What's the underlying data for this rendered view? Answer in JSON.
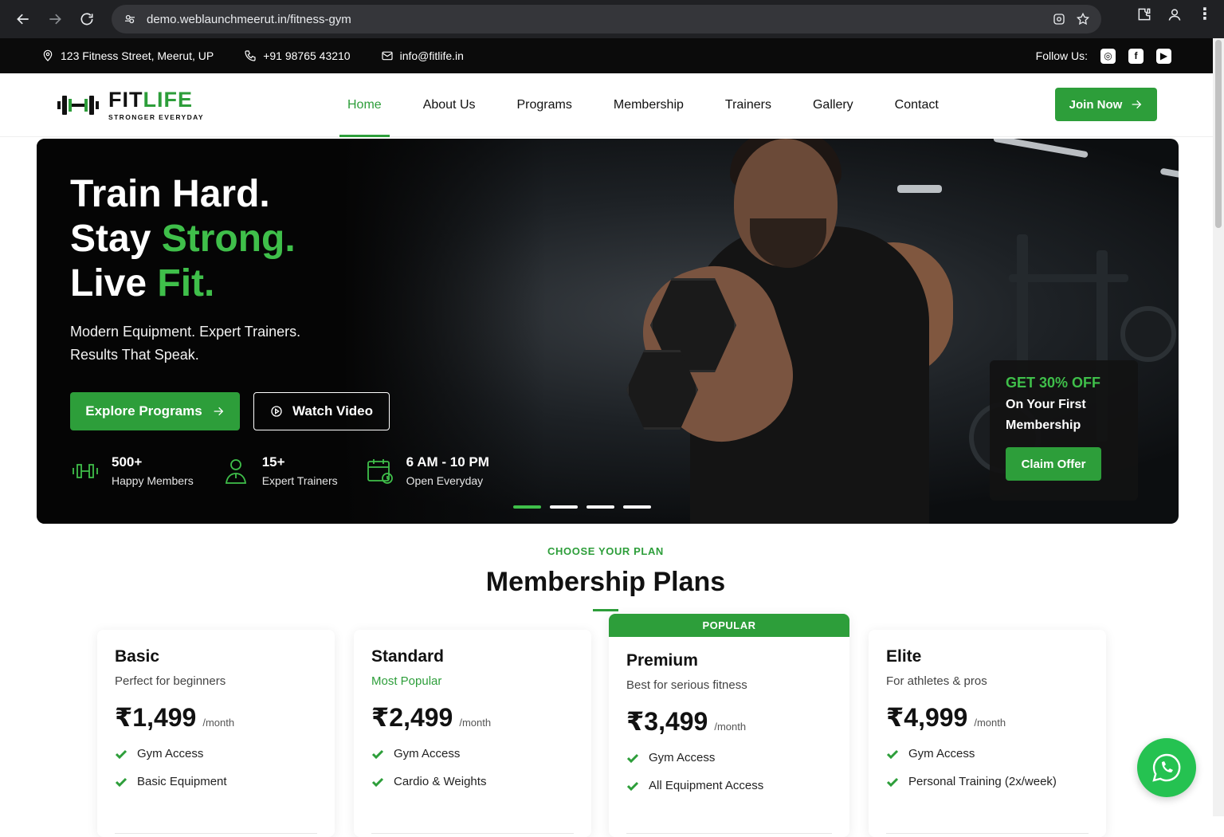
{
  "browser": {
    "url": "demo.weblaunchmeerut.in/fitness-gym"
  },
  "topbar": {
    "address": "123 Fitness Street, Meerut, UP",
    "phone": "+91 98765 43210",
    "email": "info@fitlife.in",
    "follow_label": "Follow Us:",
    "social": [
      "instagram-icon",
      "facebook-icon",
      "youtube-icon"
    ]
  },
  "header": {
    "logo_fit": "FIT",
    "logo_life": "LIFE",
    "tagline": "STRONGER EVERYDAY",
    "nav": [
      "Home",
      "About Us",
      "Programs",
      "Membership",
      "Trainers",
      "Gallery",
      "Contact"
    ],
    "active_nav": "Home",
    "join_label": "Join Now"
  },
  "hero": {
    "line1": "Train Hard.",
    "line2_a": "Stay ",
    "line2_b": "Strong.",
    "line3_a": "Live ",
    "line3_b": "Fit.",
    "sub1": "Modern Equipment. Expert Trainers.",
    "sub2": "Results That Speak.",
    "primary_btn": "Explore Programs",
    "secondary_btn": "Watch Video",
    "stats": [
      {
        "num": "500+",
        "label": "Happy Members",
        "icon": "dumbbell-icon"
      },
      {
        "num": "15+",
        "label": "Expert Trainers",
        "icon": "trainer-icon"
      },
      {
        "num": "6 AM - 10 PM",
        "label": "Open Everyday",
        "icon": "calendar-clock-icon"
      }
    ],
    "offer": {
      "title": "GET 30% OFF",
      "line1": "On Your First",
      "line2": "Membership",
      "button": "Claim Offer"
    },
    "slides_total": 4,
    "slide_active": 1
  },
  "plans": {
    "eyebrow": "CHOOSE YOUR PLAN",
    "title": "Membership Plans",
    "cards": [
      {
        "name": "Basic",
        "desc": "Perfect for beginners",
        "price": "₹1,499",
        "per": "/month",
        "features": [
          "Gym Access",
          "Basic Equipment"
        ]
      },
      {
        "name": "Standard",
        "desc": "Most Popular",
        "price": "₹2,499",
        "per": "/month",
        "features": [
          "Gym Access",
          "Cardio & Weights"
        ]
      },
      {
        "name": "Premium",
        "badge": "POPULAR",
        "desc": "Best for serious fitness",
        "price": "₹3,499",
        "per": "/month",
        "features": [
          "Gym Access",
          "All Equipment Access"
        ]
      },
      {
        "name": "Elite",
        "desc": "For athletes & pros",
        "price": "₹4,999",
        "per": "/month",
        "features": [
          "Gym Access",
          "Personal Training (2x/week)"
        ]
      }
    ]
  },
  "colors": {
    "brand_green": "#2d9e3a",
    "hero_green": "#3fbf4a",
    "whatsapp": "#25c251"
  }
}
